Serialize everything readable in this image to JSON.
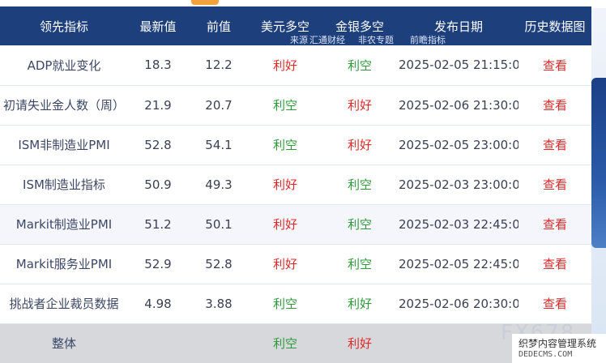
{
  "header": {
    "columns": [
      "领先指标",
      "最新值",
      "前值",
      "美元多空",
      "金银多空",
      "发布日期",
      "历史数据图"
    ],
    "source_label": "来源",
    "source_1": "汇通财经",
    "source_2": "非农专题",
    "source_3": "前瞻指标"
  },
  "rows": [
    {
      "name": "ADP就业变化",
      "latest": "18.3",
      "previous": "12.2",
      "usd": "利好",
      "gold": "利空",
      "date": "2025-02-05 21:15:00",
      "action": "查看"
    },
    {
      "name": "初请失业金人数（周）",
      "latest": "21.9",
      "previous": "20.7",
      "usd": "利空",
      "gold": "利好",
      "date": "2025-02-06 21:30:00",
      "action": "查看"
    },
    {
      "name": "ISM非制造业PMI",
      "latest": "52.8",
      "previous": "54.1",
      "usd": "利空",
      "gold": "利好",
      "date": "2025-02-05 23:00:00",
      "action": "查看"
    },
    {
      "name": "ISM制造业指标",
      "latest": "50.9",
      "previous": "49.3",
      "usd": "利好",
      "gold": "利空",
      "date": "2025-02-03 23:00:00",
      "action": "查看"
    },
    {
      "name": "Markit制造业PMI",
      "latest": "51.2",
      "previous": "50.1",
      "usd": "利好",
      "gold": "利空",
      "date": "2025-02-03 22:45:00",
      "action": "查看"
    },
    {
      "name": "Markit服务业PMI",
      "latest": "52.9",
      "previous": "52.8",
      "usd": "利好",
      "gold": "利空",
      "date": "2025-02-05 22:45:00",
      "action": "查看"
    },
    {
      "name": "挑战者企业裁员数据",
      "latest": "4.98",
      "previous": "3.88",
      "usd": "利空",
      "gold": "利好",
      "date": "2025-02-06 20:30:00",
      "action": "查看"
    }
  ],
  "total": {
    "name": "整体",
    "usd": "利空",
    "gold": "利好"
  },
  "watermark": {
    "brand": "FX678",
    "site_cn": "织梦内容管理系统",
    "site_url": "DEDECMS.COM"
  },
  "colors": {
    "header_bg": "#1d3f7c",
    "bullish": "#e02a2a",
    "bearish": "#2e9a3a",
    "view_link": "#e02a2a"
  }
}
